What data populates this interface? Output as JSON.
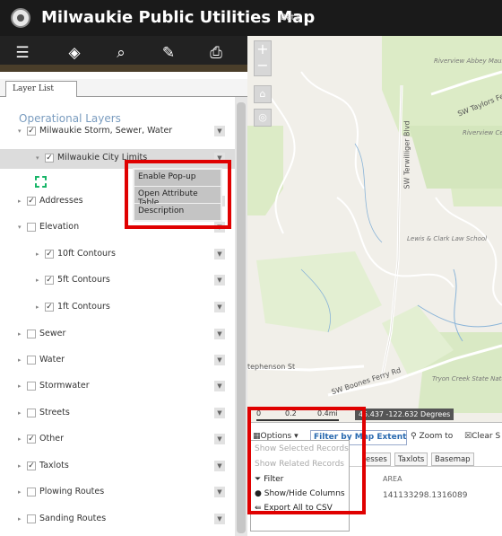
{
  "header": {
    "title": "Milwaukie Public Utilities Map",
    "beta": "Beta"
  },
  "toolbar": {
    "icons": [
      "list-icon",
      "layers-icon",
      "search-icon",
      "measure-icon",
      "print-icon"
    ]
  },
  "panel": {
    "tab": "Layer List",
    "section_title": "Operational Layers",
    "layers": [
      {
        "label": "Milwaukie Storm, Sewer, Water",
        "checked": true,
        "expanded": true
      },
      {
        "label": "Milwaukie City Limits",
        "checked": true,
        "expanded": true
      },
      {
        "label": "Addresses",
        "checked": true,
        "expanded": false
      },
      {
        "label": "Elevation",
        "checked": false,
        "expanded": true
      },
      {
        "label": "10ft Contours",
        "checked": true,
        "expanded": false
      },
      {
        "label": "5ft Contours",
        "checked": true,
        "expanded": false
      },
      {
        "label": "1ft Contours",
        "checked": true,
        "expanded": false
      },
      {
        "label": "Sewer",
        "checked": false,
        "expanded": false
      },
      {
        "label": "Water",
        "checked": false,
        "expanded": false
      },
      {
        "label": "Stormwater",
        "checked": false,
        "expanded": false
      },
      {
        "label": "Streets",
        "checked": false,
        "expanded": false
      },
      {
        "label": "Other",
        "checked": true,
        "expanded": false
      },
      {
        "label": "Taxlots",
        "checked": true,
        "expanded": false
      },
      {
        "label": "Plowing Routes",
        "checked": false,
        "expanded": false
      },
      {
        "label": "Sanding Routes",
        "checked": false,
        "expanded": false
      }
    ],
    "context_menu": [
      "Enable Pop-up",
      "Open Attribute Table",
      "Description"
    ]
  },
  "map": {
    "labels": {
      "riverview_abbey": "Riverview Abbey Mausoleum",
      "sw_taylors_ferry": "SW Taylors Ferry Rd",
      "riverview_cemetery": "Riverview Cemetery",
      "sw_terwilliger": "SW Terwilliger Blvd",
      "lewis_clark": "Lewis & Clark Law School",
      "stephenson": "tephenson St",
      "sw_boones_ferry": "SW Boones Ferry Rd",
      "tryon_creek": "Tryon Creek State Natural Area"
    },
    "scale": [
      "0",
      "0.2",
      "0.4mi"
    ],
    "coords": "45.437 -122.632 Degrees",
    "zoom_in": "+",
    "zoom_out": "−"
  },
  "attribute_table": {
    "options": "Options",
    "filter": "Filter by Map Extent",
    "zoom_to": "Zoom to",
    "clear_selection": "Clear S",
    "tabs": [
      "esses",
      "Taxlots",
      "Basemap"
    ],
    "column": "AREA",
    "value": "141133298.1316089",
    "dropdown": [
      "Show Selected Records",
      "Show Related Records",
      "Filter",
      "Show/Hide Columns",
      "Export All to CSV"
    ]
  },
  "colors": {
    "accent": "#e00000",
    "header": "#1a1a1a",
    "link": "#2a6ab0",
    "legend": "#17b568"
  }
}
